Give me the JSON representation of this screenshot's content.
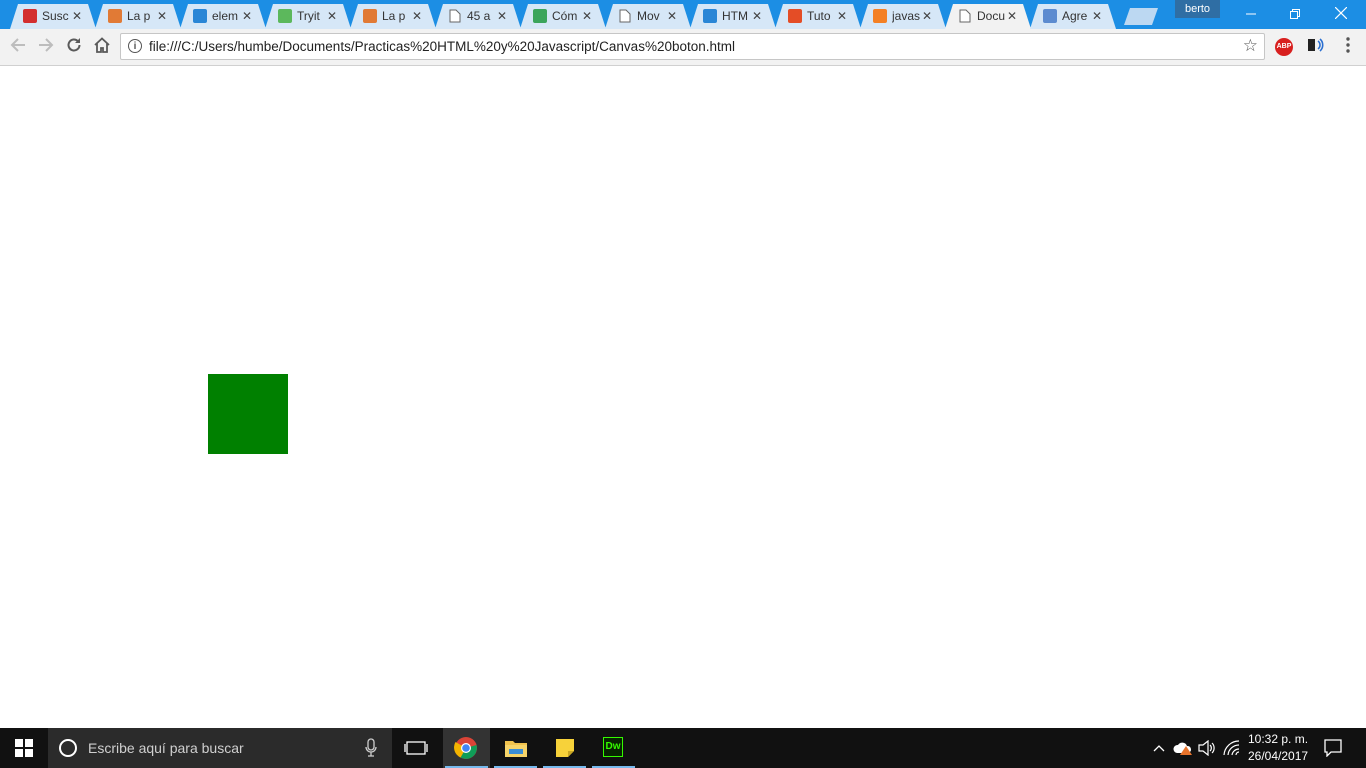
{
  "browser": {
    "tabs": [
      {
        "title": "Susc",
        "icon": "youtube-icon",
        "color": "#d32f2f"
      },
      {
        "title": "La p",
        "icon": "w3schools-icon",
        "color": "#e17a35"
      },
      {
        "title": "elem",
        "icon": "image-blue-icon",
        "color": "#2a86d6"
      },
      {
        "title": "Tryit",
        "icon": "w3-tryit-icon",
        "color": "#5cb85c"
      },
      {
        "title": "La p",
        "icon": "w3schools-icon",
        "color": "#e17a35"
      },
      {
        "title": "45 a",
        "icon": "page-icon",
        "color": "#777777"
      },
      {
        "title": "Cóm",
        "icon": "green-question-icon",
        "color": "#3ba55c"
      },
      {
        "title": "Mov",
        "icon": "page-icon",
        "color": "#777777"
      },
      {
        "title": "HTM",
        "icon": "image-blue-icon",
        "color": "#2a86d6"
      },
      {
        "title": "Tuto",
        "icon": "html5-icon",
        "color": "#e44d26"
      },
      {
        "title": "javas",
        "icon": "stackoverflow-icon",
        "color": "#f48024"
      },
      {
        "title": "Docu",
        "icon": "page-icon",
        "color": "#777777"
      },
      {
        "title": "Agre",
        "icon": "blue-site-icon",
        "color": "#5b8bd0"
      }
    ],
    "active_tab_index": 11,
    "user_label": "berto",
    "url": "file:///C:/Users/humbe/Documents/Practicas%20HTML%20y%20Javascript/Canvas%20boton.html",
    "extension_abp_label": "ABP"
  },
  "canvas": {
    "box_color": "#008000"
  },
  "taskbar": {
    "search_placeholder": "Escribe aquí para buscar",
    "apps": [
      {
        "name": "chrome",
        "icon": "chrome-icon",
        "active": true
      },
      {
        "name": "file-explorer",
        "icon": "folder-icon",
        "active": false
      },
      {
        "name": "sticky-notes",
        "icon": "sticky-notes-icon",
        "active": false
      },
      {
        "name": "dreamweaver",
        "icon": "dreamweaver-icon",
        "label": "Dw",
        "active": false
      }
    ],
    "time": "10:32 p. m.",
    "date": "26/04/2017"
  }
}
